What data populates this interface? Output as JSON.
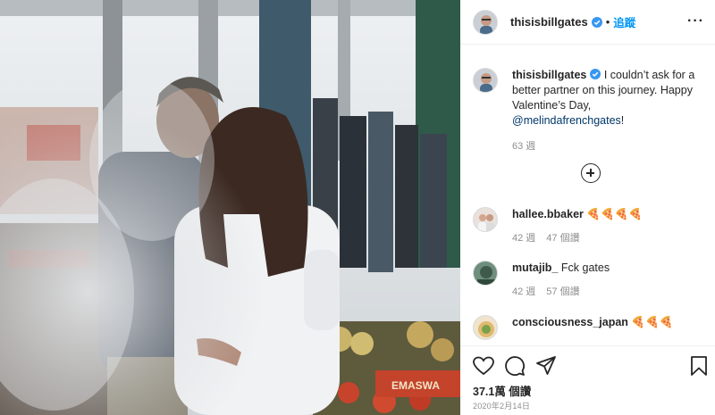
{
  "post": {
    "username": "thisisbillgates",
    "follow_label": "追蹤",
    "separator": "•",
    "more_label": "···",
    "photo_sign": "EMASWA"
  },
  "caption": {
    "username": "thisisbillgates",
    "text": " I couldn’t ask for a better partner on this journey. Happy Valentine’s Day, ",
    "mention": "@melindafrenchgates",
    "end": "!",
    "age": "63 週"
  },
  "comments": [
    {
      "username": "hallee.bbaker",
      "text": " 🍕🍕🍕🍕",
      "age": "42 週",
      "replies": "47 個讚"
    },
    {
      "username": "mutajib_",
      "text": " Fck gates",
      "age": "42 週",
      "replies": "57 個讚"
    },
    {
      "username": "consciousness_japan",
      "text": " 🍕🍕🍕",
      "age": "",
      "replies": ""
    }
  ],
  "footer": {
    "likes": "37.1萬 個讚",
    "date": "2020年2月14日"
  },
  "icons": {
    "verified": "verified-badge-icon",
    "like": "heart-icon",
    "comment": "speech-bubble-icon",
    "share": "paper-plane-icon",
    "save": "bookmark-icon",
    "load": "plus-circle-icon"
  },
  "colors": {
    "link": "#0095f6",
    "mention": "#00376b",
    "meta": "#8e8e8e",
    "text": "#262626"
  }
}
